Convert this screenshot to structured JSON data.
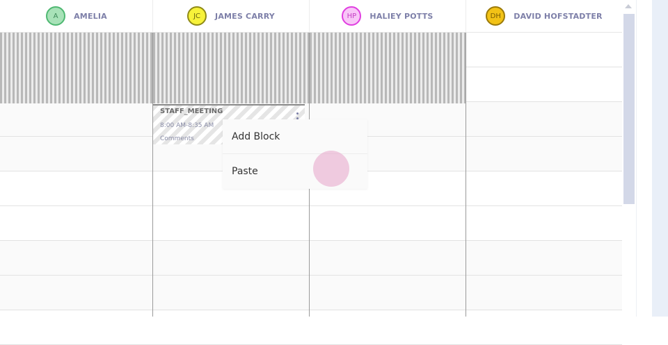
{
  "staff": [
    {
      "name": "AMELIA",
      "initials": "A",
      "bg": "#a8e2b8",
      "border": "#4fb872",
      "text": "#3f8a5a"
    },
    {
      "name": "JAMES CARRY",
      "initials": "JC",
      "bg": "#f7f23a",
      "border": "#8f8a16",
      "text": "#6a6510"
    },
    {
      "name": "HALIEY POTTS",
      "initials": "HP",
      "bg": "#f8c6f7",
      "border": "#e03ee0",
      "text": "#c43dc4"
    },
    {
      "name": "DAVID HOFSTADTER",
      "initials": "DH",
      "bg": "#f2c216",
      "border": "#9b7a0a",
      "text": "#7a5c00"
    }
  ],
  "event": {
    "title": "STAFF_MEETING",
    "time": "8:00 AM-8:35 AM",
    "comments": "Comments"
  },
  "context_menu": {
    "items": [
      "Add Block",
      "Paste"
    ]
  }
}
